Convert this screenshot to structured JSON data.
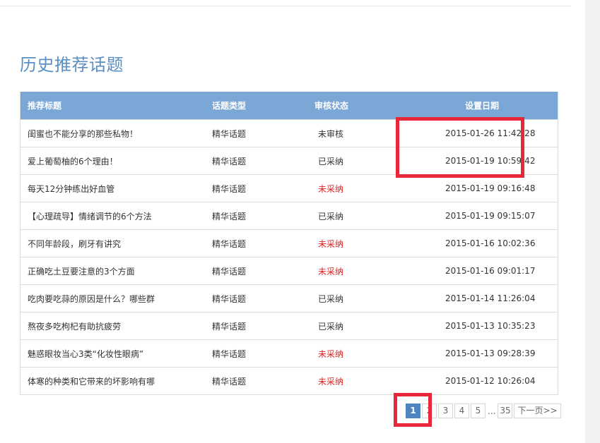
{
  "page": {
    "title": "历史推荐话题"
  },
  "table": {
    "headers": {
      "title": "推荐标题",
      "type": "话题类型",
      "status": "审核状态",
      "date": "设置日期"
    },
    "rows": [
      {
        "title": "闺蜜也不能分享的那些私物！",
        "type": "精华话题",
        "status": "未审核",
        "status_color": "normal",
        "date": "2015-01-26 11:42:28"
      },
      {
        "title": "爱上葡萄柚的6个理由！",
        "type": "精华话题",
        "status": "已采纳",
        "status_color": "normal",
        "date": "2015-01-19 10:59:42"
      },
      {
        "title": "每天12分钟练出好血管",
        "type": "精华话题",
        "status": "未采纳",
        "status_color": "red",
        "date": "2015-01-19 09:16:48"
      },
      {
        "title": "【心理疏导】情绪调节的6个方法",
        "type": "精华话题",
        "status": "已采纳",
        "status_color": "normal",
        "date": "2015-01-19 09:15:07"
      },
      {
        "title": "不同年龄段，刷牙有讲究",
        "type": "精华话题",
        "status": "未采纳",
        "status_color": "red",
        "date": "2015-01-16 10:02:36"
      },
      {
        "title": "正确吃土豆要注意的3个方面",
        "type": "精华话题",
        "status": "未采纳",
        "status_color": "red",
        "date": "2015-01-16 09:01:17"
      },
      {
        "title": "吃肉要吃蒜的原因是什么？哪些群",
        "type": "精华话题",
        "status": "已采纳",
        "status_color": "normal",
        "date": "2015-01-14 11:26:04"
      },
      {
        "title": "熬夜多吃枸杞有助抗疲劳",
        "type": "精华话题",
        "status": "已采纳",
        "status_color": "normal",
        "date": "2015-01-13 10:35:23"
      },
      {
        "title": "魅惑眼妆当心3类“化妆性眼病”",
        "type": "精华话题",
        "status": "未采纳",
        "status_color": "red",
        "date": "2015-01-13 09:28:39"
      },
      {
        "title": "体寒的种类和它带来的坏影响有哪",
        "type": "精华话题",
        "status": "未采纳",
        "status_color": "red",
        "date": "2015-01-12 10:26:04"
      }
    ]
  },
  "pagination": {
    "current": "1",
    "pages": [
      "2",
      "3",
      "4",
      "5"
    ],
    "ellipsis": "...",
    "last": "35",
    "next_label": "下一页>>"
  },
  "colors": {
    "header_bg": "#7aa7d6",
    "title": "#5b8fc4",
    "status_red": "#e02020",
    "highlight": "#e8283a",
    "pager_active": "#4f86c1"
  }
}
